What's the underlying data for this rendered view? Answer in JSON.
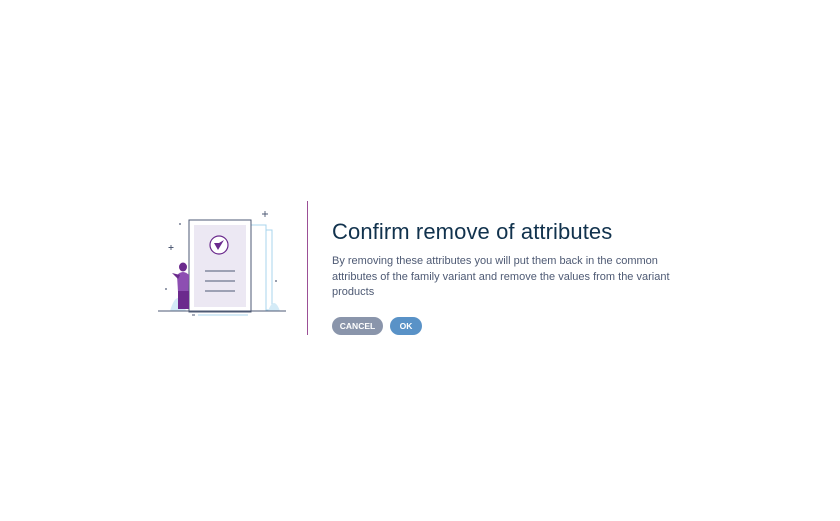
{
  "dialog": {
    "title": "Confirm remove of attributes",
    "description": "By removing these attributes you will put them back in the common attributes of the family variant and remove the values from the variant products",
    "cancel_label": "CANCEL",
    "ok_label": "OK"
  },
  "colors": {
    "title": "#11324d",
    "text": "#4e5a74",
    "divider": "#9b4f96",
    "cancel_button": "#8a95ab",
    "ok_button": "#5992c7",
    "accent_purple": "#6b2a8d"
  },
  "icons": {
    "illustration": "document-with-checkmark-illustration"
  }
}
